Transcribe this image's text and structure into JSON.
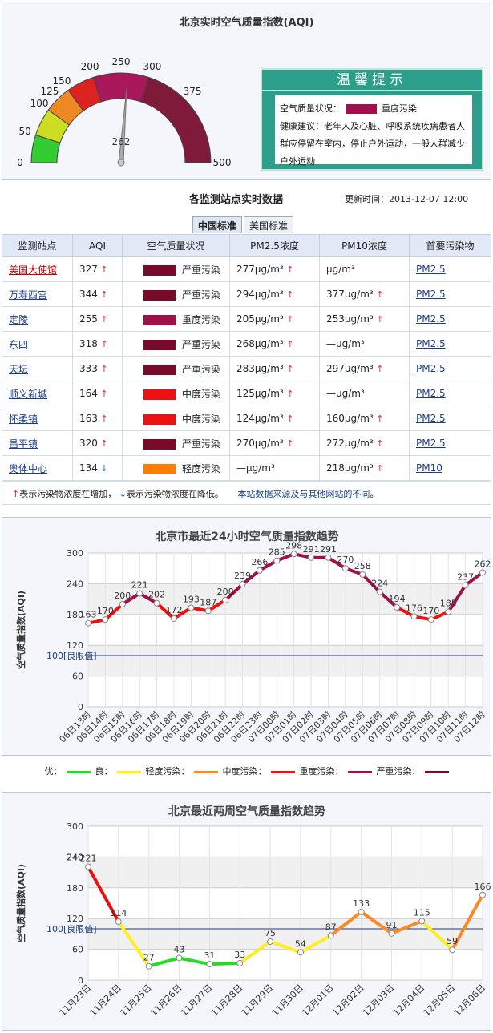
{
  "gauge": {
    "title": "北京实时空气质量指数(AQI)",
    "value": 262,
    "value_label": "262",
    "ticks": [
      "0",
      "50",
      "100",
      "125",
      "150",
      "200",
      "250",
      "300",
      "375",
      "500"
    ]
  },
  "tip": {
    "heading": "温馨提示",
    "level_label": "空气质量状况：",
    "level_value": "重度污染",
    "advice_label": "健康建议：",
    "advice_text": "老年人及心脏、呼吸系统疾病患者人群应停留在室内，停止户外运动，一般人群减少户外运动",
    "color": "#a0104a"
  },
  "stations": {
    "title": "各监测站点实时数据",
    "updated": "更新时间：2013-12-07 12:00",
    "tabs": [
      "中国标准",
      "美国标准"
    ],
    "headers": [
      "监测站点",
      "AQI",
      "空气质量状况",
      "PM2.5浓度",
      "PM10浓度",
      "首要污染物"
    ],
    "rows": [
      {
        "name": "美国大使馆",
        "aqi": "327",
        "trend": "up",
        "level": "严重污染",
        "color": "#7a0a2a",
        "pm25": "277μg/m³",
        "pm25_trend": "up",
        "pm10": "μg/m³",
        "pm10_trend": "",
        "primary": "PM2.5",
        "red": true
      },
      {
        "name": "万寿西宫",
        "aqi": "344",
        "trend": "up",
        "level": "严重污染",
        "color": "#7a0a2a",
        "pm25": "294μg/m³",
        "pm25_trend": "up",
        "pm10": "377μg/m³",
        "pm10_trend": "up",
        "primary": "PM2.5",
        "red": false
      },
      {
        "name": "定陵",
        "aqi": "255",
        "trend": "up",
        "level": "重度污染",
        "color": "#a0104a",
        "pm25": "205μg/m³",
        "pm25_trend": "up",
        "pm10": "253μg/m³",
        "pm10_trend": "up",
        "primary": "PM2.5",
        "red": false
      },
      {
        "name": "东四",
        "aqi": "318",
        "trend": "up",
        "level": "严重污染",
        "color": "#7a0a2a",
        "pm25": "268μg/m³",
        "pm25_trend": "up",
        "pm10": "—μg/m³",
        "pm10_trend": "",
        "primary": "PM2.5",
        "red": false
      },
      {
        "name": "天坛",
        "aqi": "333",
        "trend": "up",
        "level": "严重污染",
        "color": "#7a0a2a",
        "pm25": "283μg/m³",
        "pm25_trend": "up",
        "pm10": "297μg/m³",
        "pm10_trend": "up",
        "primary": "PM2.5",
        "red": false
      },
      {
        "name": "顺义新城",
        "aqi": "164",
        "trend": "up",
        "level": "中度污染",
        "color": "#ee1111",
        "pm25": "125μg/m³",
        "pm25_trend": "up",
        "pm10": "—μg/m³",
        "pm10_trend": "",
        "primary": "PM2.5",
        "red": false
      },
      {
        "name": "怀柔镇",
        "aqi": "163",
        "trend": "up",
        "level": "中度污染",
        "color": "#ee1111",
        "pm25": "124μg/m³",
        "pm25_trend": "up",
        "pm10": "160μg/m³",
        "pm10_trend": "up",
        "primary": "PM2.5",
        "red": false
      },
      {
        "name": "昌平镇",
        "aqi": "320",
        "trend": "up",
        "level": "严重污染",
        "color": "#7a0a2a",
        "pm25": "270μg/m³",
        "pm25_trend": "up",
        "pm10": "272μg/m³",
        "pm10_trend": "up",
        "primary": "PM2.5",
        "red": false
      },
      {
        "name": "奥体中心",
        "aqi": "134",
        "trend": "down",
        "level": "轻度污染",
        "color": "#ff7e00",
        "pm25": "—μg/m³",
        "pm25_trend": "",
        "pm10": "218μg/m³",
        "pm10_trend": "up",
        "primary": "PM10",
        "red": false
      }
    ],
    "legend_up": "表示污染物浓度在增加，",
    "legend_down": "表示污染物浓度在降低。",
    "source_link": "本站数据来源及与其他网站的不同"
  },
  "levels_legend": {
    "items": [
      {
        "label": "优：",
        "color": "#22dd22"
      },
      {
        "label": "良：",
        "color": "#ffee22"
      },
      {
        "label": "轻度污染：",
        "color": "#ff8822"
      },
      {
        "label": "中度污染：",
        "color": "#ee1111"
      },
      {
        "label": "重度污染：",
        "color": "#a0104a"
      },
      {
        "label": "严重污染：",
        "color": "#7a0a2a"
      }
    ]
  },
  "chart_data": [
    {
      "type": "line",
      "title": "北京市最近24小时空气质量指数趋势",
      "ylabel": "空气质量指数(AQI)",
      "ylim": [
        0,
        300
      ],
      "yticks": [
        0,
        60,
        120,
        180,
        240,
        300
      ],
      "limit_label": "100[良限值]",
      "limit_value": 100,
      "categories": [
        "06日13时",
        "06日14时",
        "06日15时",
        "06日16时",
        "06日17时",
        "06日18时",
        "06日19时",
        "06日20时",
        "06日21时",
        "06日22时",
        "06日23时",
        "07日00时",
        "07日01时",
        "07日02时",
        "07日03时",
        "07日04时",
        "07日05时",
        "07日06时",
        "07日07时",
        "07日08时",
        "07日09时",
        "07日10时",
        "07日11时",
        "07日12时"
      ],
      "values": [
        163,
        170,
        200,
        221,
        202,
        172,
        193,
        187,
        208,
        239,
        266,
        285,
        298,
        291,
        291,
        270,
        258,
        224,
        194,
        176,
        170,
        185,
        237,
        262
      ]
    },
    {
      "type": "line",
      "title": "北京最近两周空气质量指数趋势",
      "ylabel": "空气质量指数(AQI)",
      "ylim": [
        0,
        300
      ],
      "yticks": [
        0,
        60,
        120,
        180,
        240,
        300
      ],
      "limit_label": "100[良限值]",
      "limit_value": 100,
      "categories": [
        "11月23日",
        "11月24日",
        "11月25日",
        "11月26日",
        "11月27日",
        "11月28日",
        "11月29日",
        "11月30日",
        "12月01日",
        "12月02日",
        "12月03日",
        "12月04日",
        "12月05日",
        "12月06日"
      ],
      "values": [
        221,
        114,
        27,
        43,
        31,
        33,
        75,
        54,
        87,
        133,
        91,
        115,
        59,
        166
      ],
      "y_extra_label": "240"
    }
  ]
}
